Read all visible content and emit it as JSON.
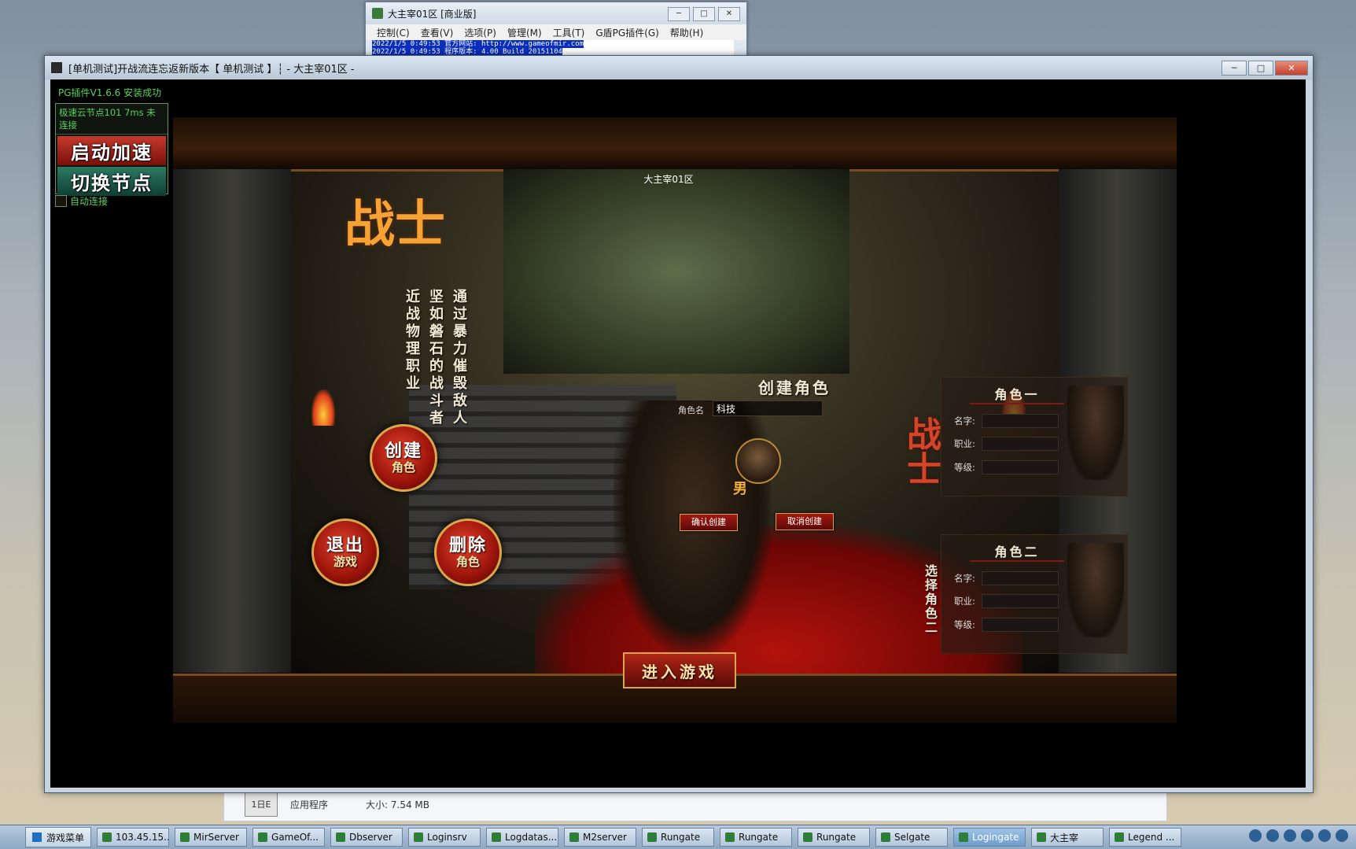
{
  "bg_window": {
    "title": "大主宰01区 [商业版]",
    "menu": [
      "控制(C)",
      "查看(V)",
      "选项(P)",
      "管理(M)",
      "工具(T)",
      "G盾PG插件(G)",
      "帮助(H)"
    ],
    "log_lines": [
      "2022/1/5 0:49:53 官方网站: http://www.gameofmir.com",
      "2022/1/5 0:49:53 程序版本: 4.00 Build 20151104"
    ]
  },
  "explorer": {
    "file_icon": "1日E",
    "file_type": "应用程序",
    "file_size": "大小: 7.54 MB"
  },
  "game_window": {
    "title": "[单机测试]开战流连忘返新版本【 单机测试 】┆ - 大主宰01区 -"
  },
  "plugin": {
    "status": "PG插件V1.6.6 安装成功",
    "node": "极速云节点101 7ms 未连接",
    "start_label": "启动加速",
    "switch_label": "切换节点",
    "auto_connect": "自动连接"
  },
  "scene": {
    "server_name": "大主宰01区",
    "class_big": "战士",
    "desc_col1": "通过暴力催毁敌人",
    "desc_col2": "坚如磐石的战斗者",
    "desc_col3": "近战物理职业",
    "btn_create": {
      "l1": "创建",
      "l2": "角色"
    },
    "btn_exit": {
      "l1": "退出",
      "l2": "游戏"
    },
    "btn_delete": {
      "l1": "删除",
      "l2": "角色"
    },
    "create_title": "创建角色",
    "name_label": "角色名",
    "name_value": "科技",
    "gender": "男",
    "confirm": "确认创建",
    "cancel": "取消创建",
    "class_mid": "战士",
    "slot1": {
      "head": "角色一",
      "name_label": "名字:",
      "job_label": "职业:",
      "level_label": "等级:"
    },
    "slot2": {
      "head": "角色二",
      "name_label": "名字:",
      "job_label": "职业:",
      "level_label": "等级:"
    },
    "select_second": "选择角色二",
    "enter_game": "进入游戏"
  },
  "taskbar": {
    "start": "游戏菜单",
    "items": [
      "103.45.15...",
      "MirServer",
      "GameOf...",
      "Dbserver",
      "Loginsrv",
      "Logdatas...",
      "M2server",
      "Rungate",
      "Rungate",
      "Rungate",
      "Selgate",
      "Logingate",
      "大主宰",
      "Legend ..."
    ],
    "active_index": 11
  }
}
